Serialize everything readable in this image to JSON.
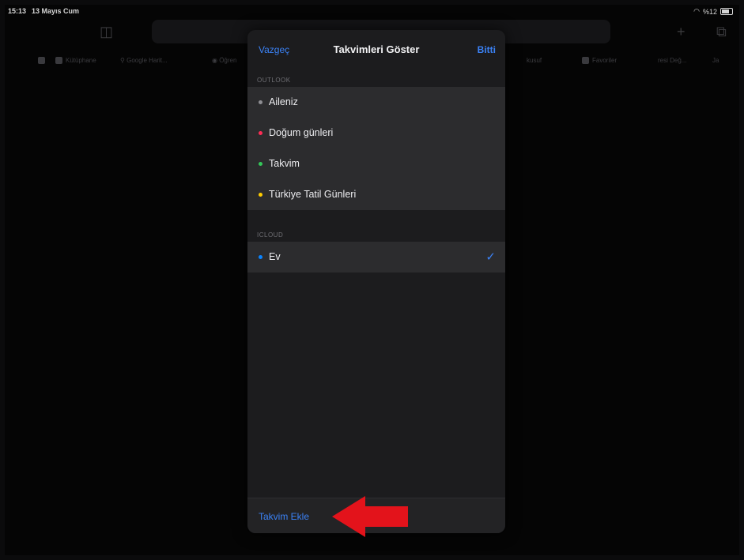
{
  "status_bar": {
    "time": "15:13",
    "date": "13 Mayıs Cum",
    "battery": "%12"
  },
  "favorites_bar": {
    "items": [
      {
        "label": "Kütüphane"
      },
      {
        "label": "Google Harit..."
      },
      {
        "label": "Öğren"
      },
      {
        "label": "Favoriler"
      },
      {
        "label": "kusuf"
      },
      {
        "label": "Favoriler"
      },
      {
        "label": "resi Değ..."
      },
      {
        "label": "Ja"
      }
    ]
  },
  "sheet": {
    "cancel_label": "Vazgeç",
    "title": "Takvimleri Göster",
    "done_label": "Bitti",
    "sections": [
      {
        "header": "OUTLOOK",
        "items": [
          {
            "label": "Aileniz",
            "color": "#8e8e93",
            "checked": false
          },
          {
            "label": "Doğum günleri",
            "color": "#ff2d55",
            "checked": false
          },
          {
            "label": "Takvim",
            "color": "#34c759",
            "checked": false
          },
          {
            "label": "Türkiye Tatil Günleri",
            "color": "#ffcc00",
            "checked": false
          }
        ]
      },
      {
        "header": "ICLOUD",
        "items": [
          {
            "label": "Ev",
            "color": "#0a84ff",
            "checked": true
          }
        ]
      }
    ],
    "add_calendar_label": "Takvim Ekle"
  },
  "annotation": {
    "arrow_color": "#e3131b"
  }
}
